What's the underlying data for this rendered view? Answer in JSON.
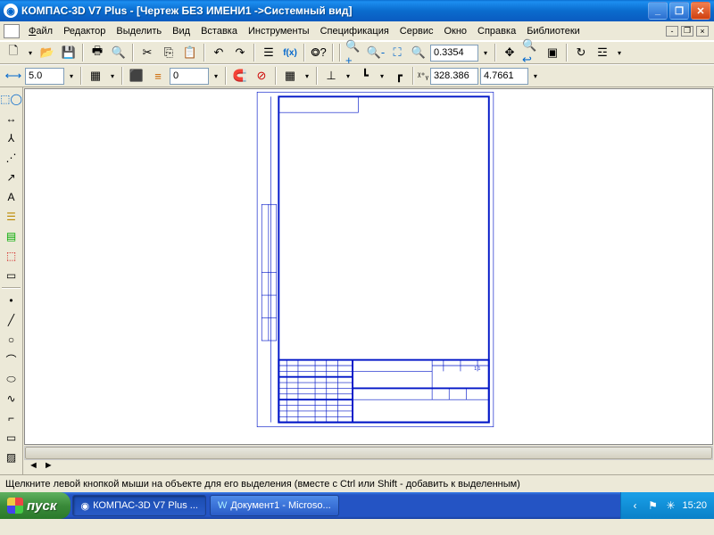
{
  "window": {
    "title": "КОМПАС-3D V7 Plus - [Чертеж БЕЗ ИМЕНИ1 ->Системный вид]"
  },
  "menu": {
    "file": "Файл",
    "edit": "Редактор",
    "select": "Выделить",
    "view": "Вид",
    "insert": "Вставка",
    "tools": "Инструменты",
    "spec": "Спецификация",
    "service": "Сервис",
    "window": "Окно",
    "help": "Справка",
    "libs": "Библиотеки"
  },
  "tb1": {
    "zoom_value": "0.3354"
  },
  "tb2": {
    "step": "5.0",
    "layer": "0",
    "coord_x": "328.386",
    "coord_y": "4.7661"
  },
  "titleblock": {
    "sheet_count": "1 1",
    "format_label": "",
    "top_cell": ""
  },
  "status": {
    "hint": "Щелкните левой кнопкой мыши на объекте для его выделения (вместе с Ctrl или Shift - добавить к выделенным)"
  },
  "taskbar": {
    "start": "пуск",
    "app1": "КОМПАС-3D V7 Plus ...",
    "app2": "Документ1 - Microso...",
    "clock": "15:20"
  }
}
